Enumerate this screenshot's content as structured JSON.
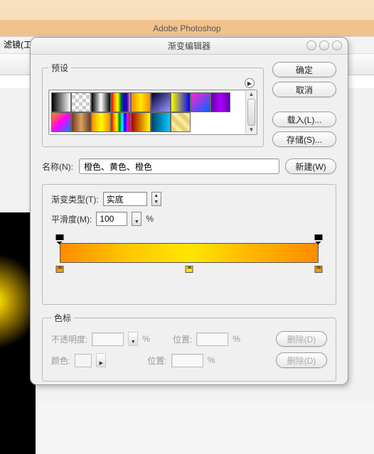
{
  "app_title": "Adobe Photoshop",
  "menu_fragment": "滤镜(工)",
  "dialog": {
    "title": "渐变编辑器",
    "presets_label": "预设",
    "buttons": {
      "ok": "确定",
      "cancel": "取消",
      "load": "载入(L)...",
      "save": "存储(S)...",
      "new": "新建(W)"
    },
    "name_label": "名称(N):",
    "name_value": "橙色、黄色、橙色",
    "gradient_type_label": "渐变类型(T):",
    "gradient_type_value": "实底",
    "smoothness_label": "平滑度(M):",
    "smoothness_value": "100",
    "percent": "%",
    "stops_label": "色标",
    "opacity_label": "不透明度:",
    "color_label": "颜色:",
    "position_label": "位置:",
    "delete_label": "删除(D)",
    "gradient_css": "linear-gradient(90deg, #ff8c00 0%, #ffc400 25%, #ffe600 50%, #ffb400 75%, #ff8c00 100%)",
    "presets": [
      "linear-gradient(90deg,#000,#fff)",
      "repeating-conic-gradient(#ccc 0 25%, #fff 0 50%) 0/10px 10px",
      "linear-gradient(90deg,#000,#fff 50%,#000)",
      "linear-gradient(90deg,red,orange,yellow,green,blue,indigo,violet)",
      "linear-gradient(90deg,#ff8c00,#ffe600,#ff8c00)",
      "linear-gradient(135deg,#003,#99f)",
      "linear-gradient(90deg,#ff0,#00f)",
      "linear-gradient(135deg,#f2c,#06f)",
      "linear-gradient(90deg,#60a,#a0f,#60a)",
      "linear-gradient(135deg,#f80,#f0f,#08f)",
      "linear-gradient(90deg,#6b3f1d,#d9a066,#6b3f1d)",
      "linear-gradient(90deg,#f80,#ff0,#f80)",
      "linear-gradient(90deg,red,orange,yellow,green,cyan,blue,magenta,red)",
      "linear-gradient(90deg,#a00,#ff0)",
      "linear-gradient(90deg,#046,#0cf)",
      "repeating-linear-gradient(45deg,#e8d070 0 6px,#f5e8a0 6px 12px)"
    ]
  }
}
